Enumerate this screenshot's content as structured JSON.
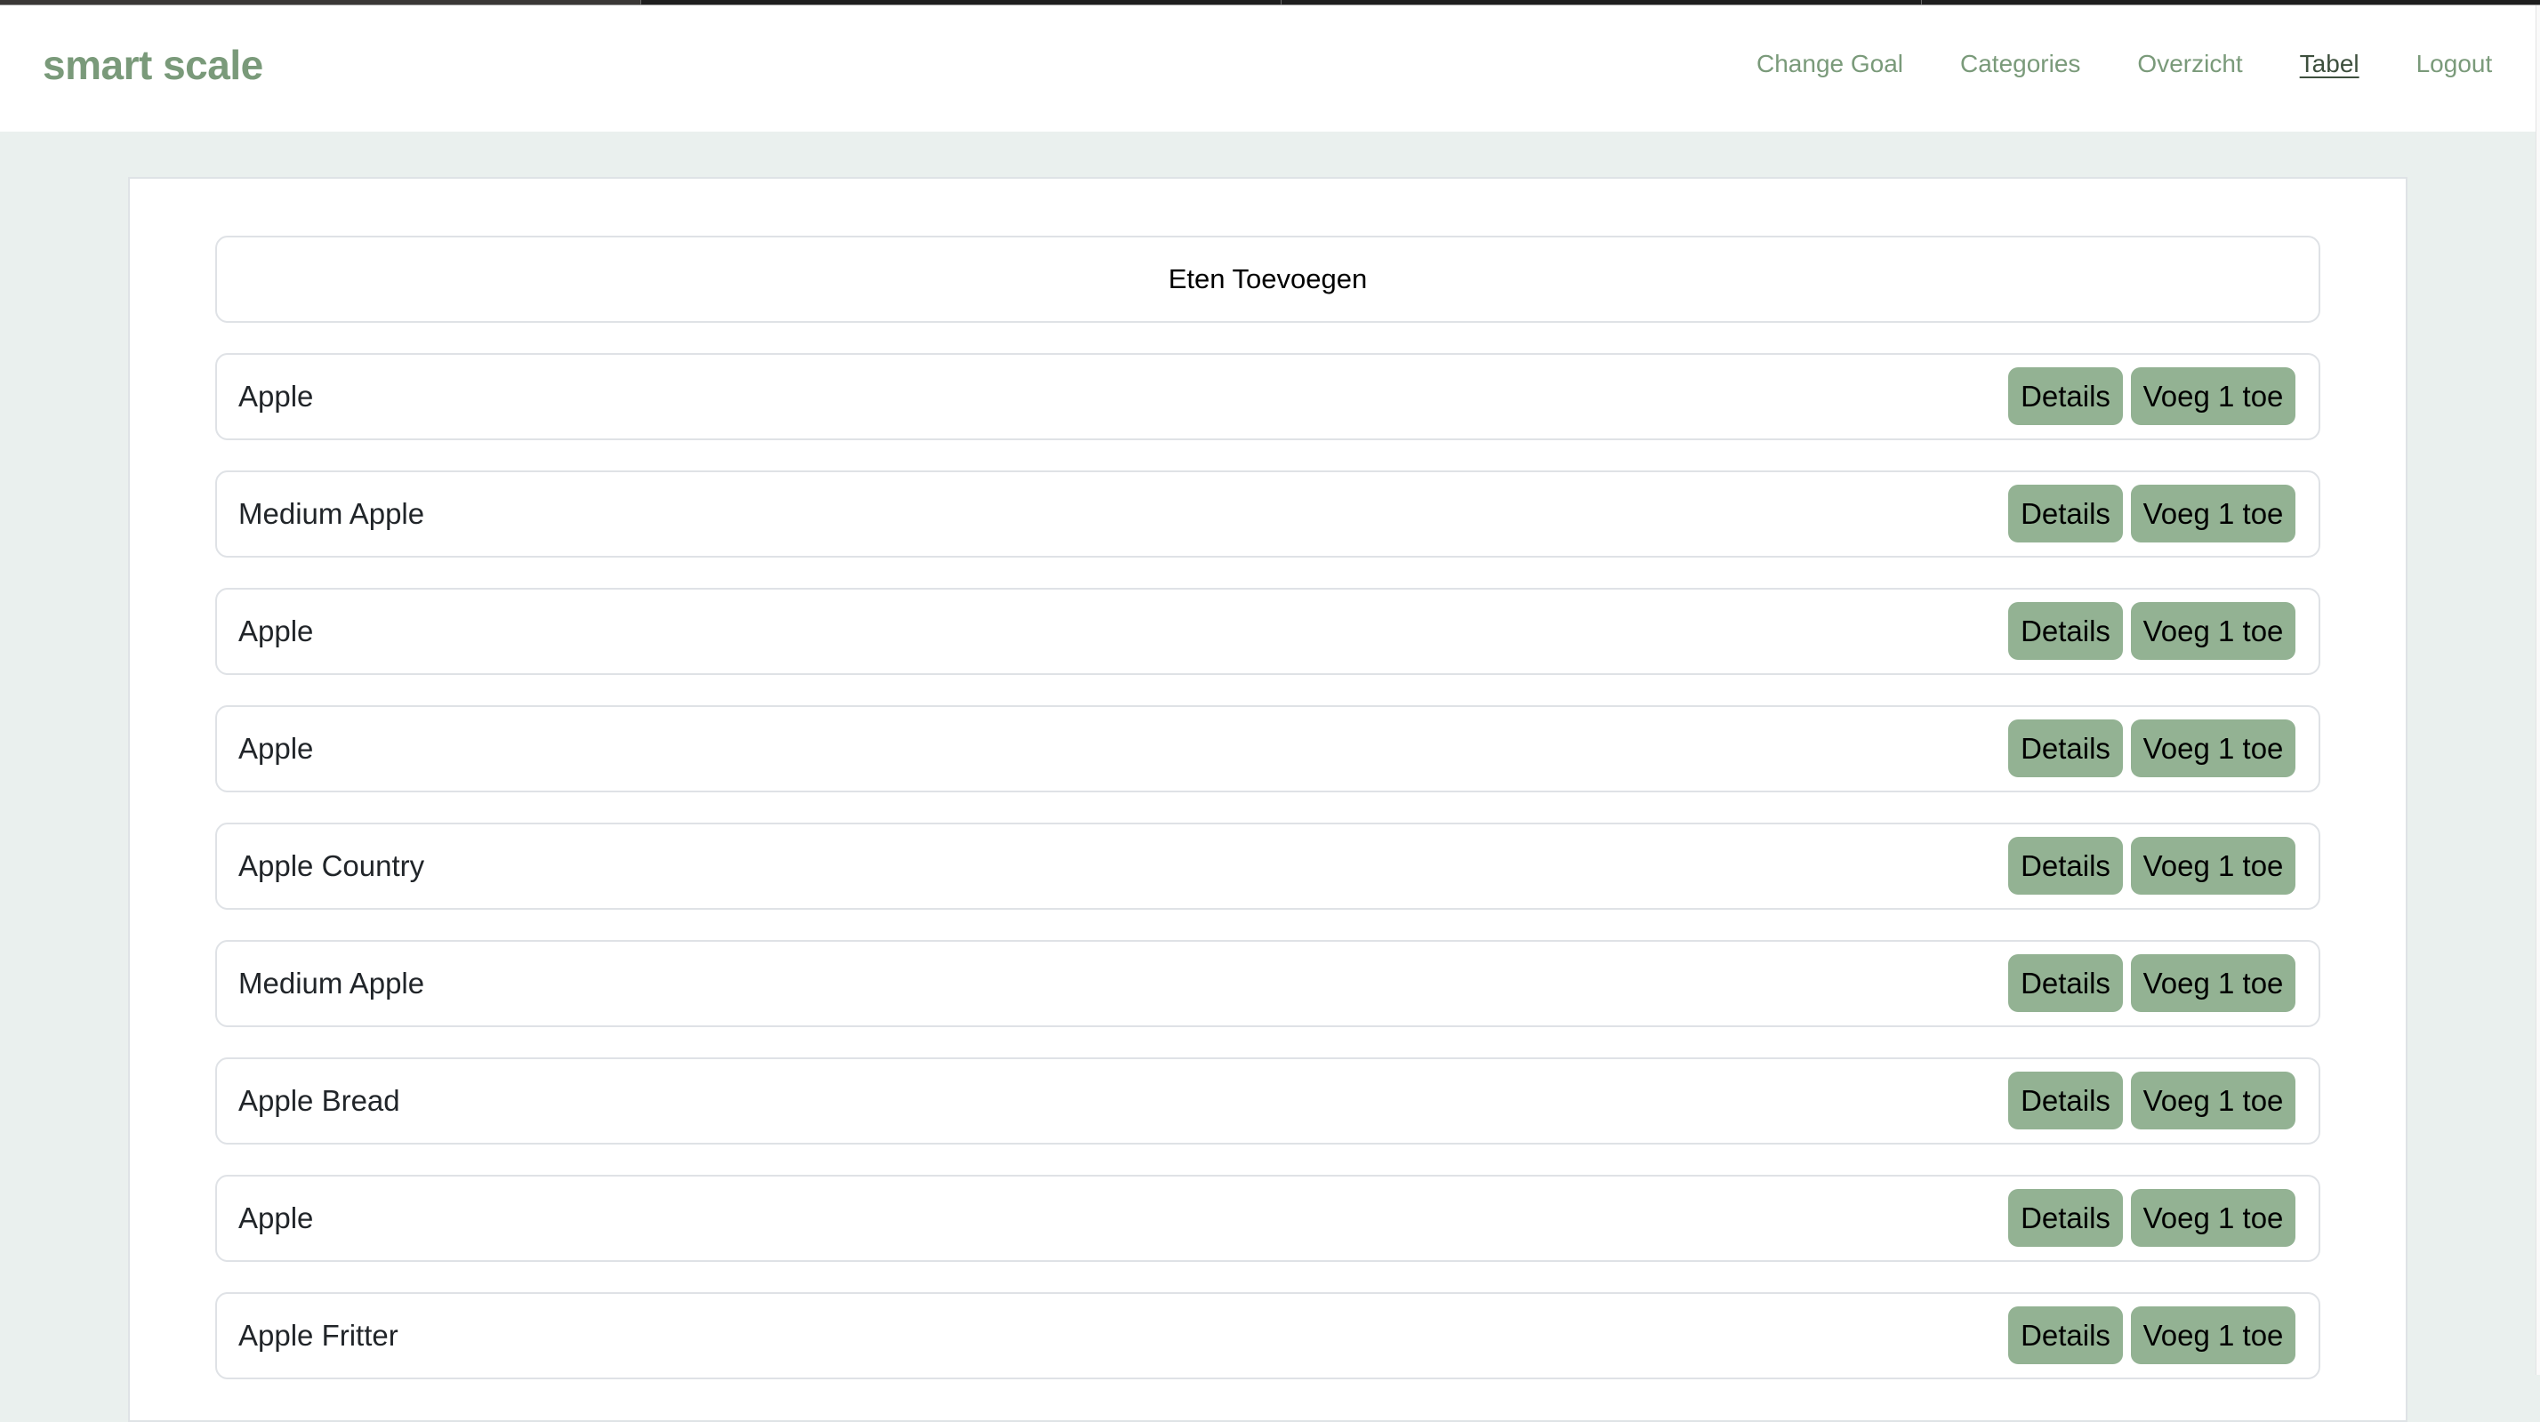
{
  "app": {
    "logo": "smart scale"
  },
  "nav": {
    "items": [
      {
        "label": "Change Goal",
        "active": false
      },
      {
        "label": "Categories",
        "active": false
      },
      {
        "label": "Overzicht",
        "active": false
      },
      {
        "label": "Tabel",
        "active": true
      },
      {
        "label": "Logout",
        "active": false
      }
    ]
  },
  "colors": {
    "brand_green": "#7a9a7a",
    "active_nav": "#3d4f3d",
    "button_green": "#93b293",
    "page_background": "#eaf0ee"
  },
  "main": {
    "add_food_label": "Eten Toevoegen",
    "details_label": "Details",
    "add_one_label": "Voeg 1 toe",
    "foods": [
      {
        "name": "Apple"
      },
      {
        "name": "Medium Apple"
      },
      {
        "name": "Apple"
      },
      {
        "name": "Apple"
      },
      {
        "name": "Apple Country"
      },
      {
        "name": "Medium Apple"
      },
      {
        "name": "Apple Bread"
      },
      {
        "name": "Apple"
      },
      {
        "name": "Apple Fritter"
      }
    ]
  }
}
